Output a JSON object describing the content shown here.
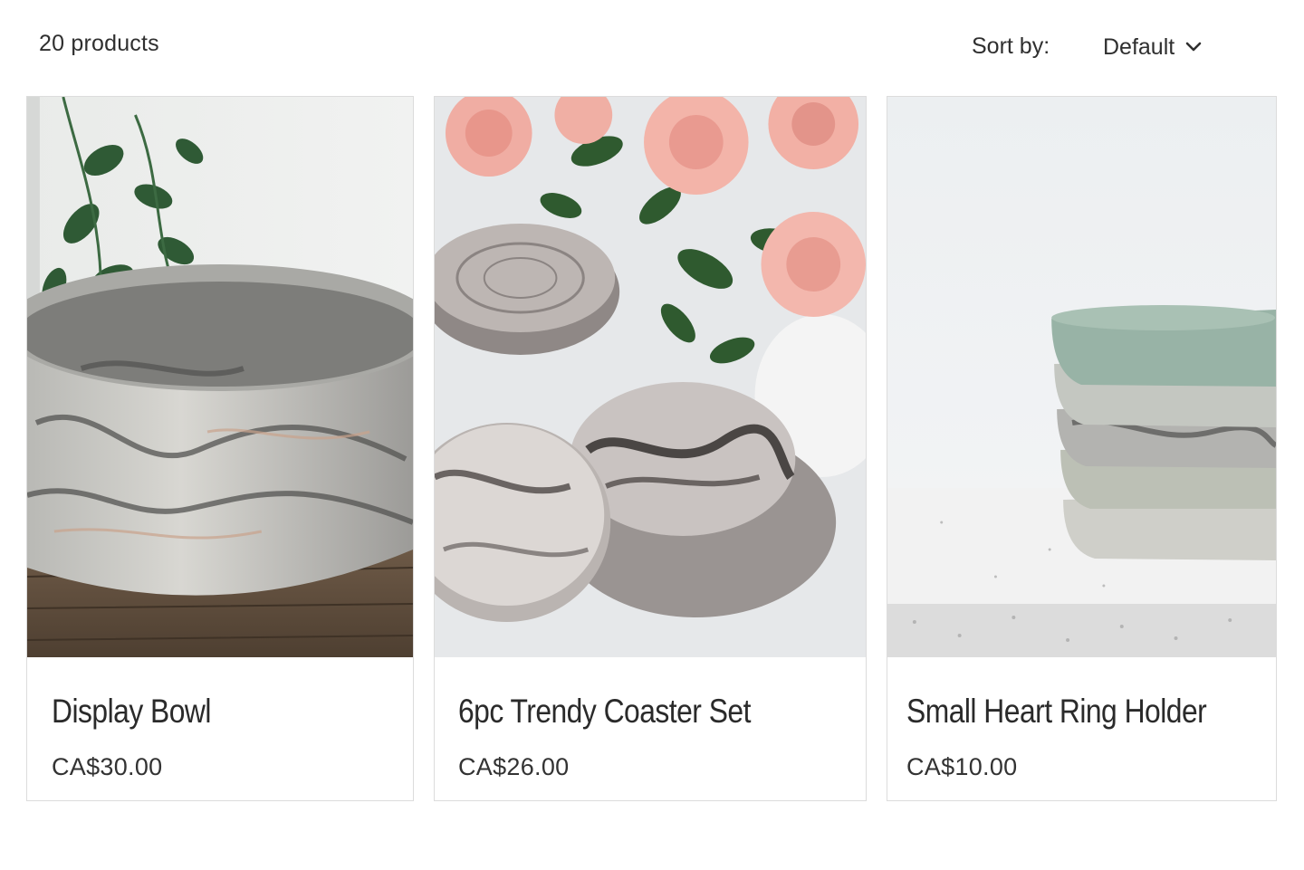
{
  "toolbar": {
    "product_count": "20 products",
    "sort_label": "Sort by:",
    "sort_value": "Default",
    "sort_icon": "chevron-down-icon"
  },
  "products": [
    {
      "title": "Display Bowl",
      "price": "CA$30.00",
      "image": "marble-display-bowl-photo"
    },
    {
      "title": "6pc Trendy Coaster Set",
      "price": "CA$26.00",
      "image": "marble-coasters-with-roses-photo"
    },
    {
      "title": "Small Heart Ring Holder",
      "price": "CA$10.00",
      "image": "stacked-heart-dishes-photo"
    }
  ],
  "colors": {
    "text": "#2b2b2b",
    "border": "#dcdcdc",
    "marble_gray": "#8a8a88",
    "rose_pink": "#f2b0a6",
    "sage_green": "#9fb6a8"
  }
}
